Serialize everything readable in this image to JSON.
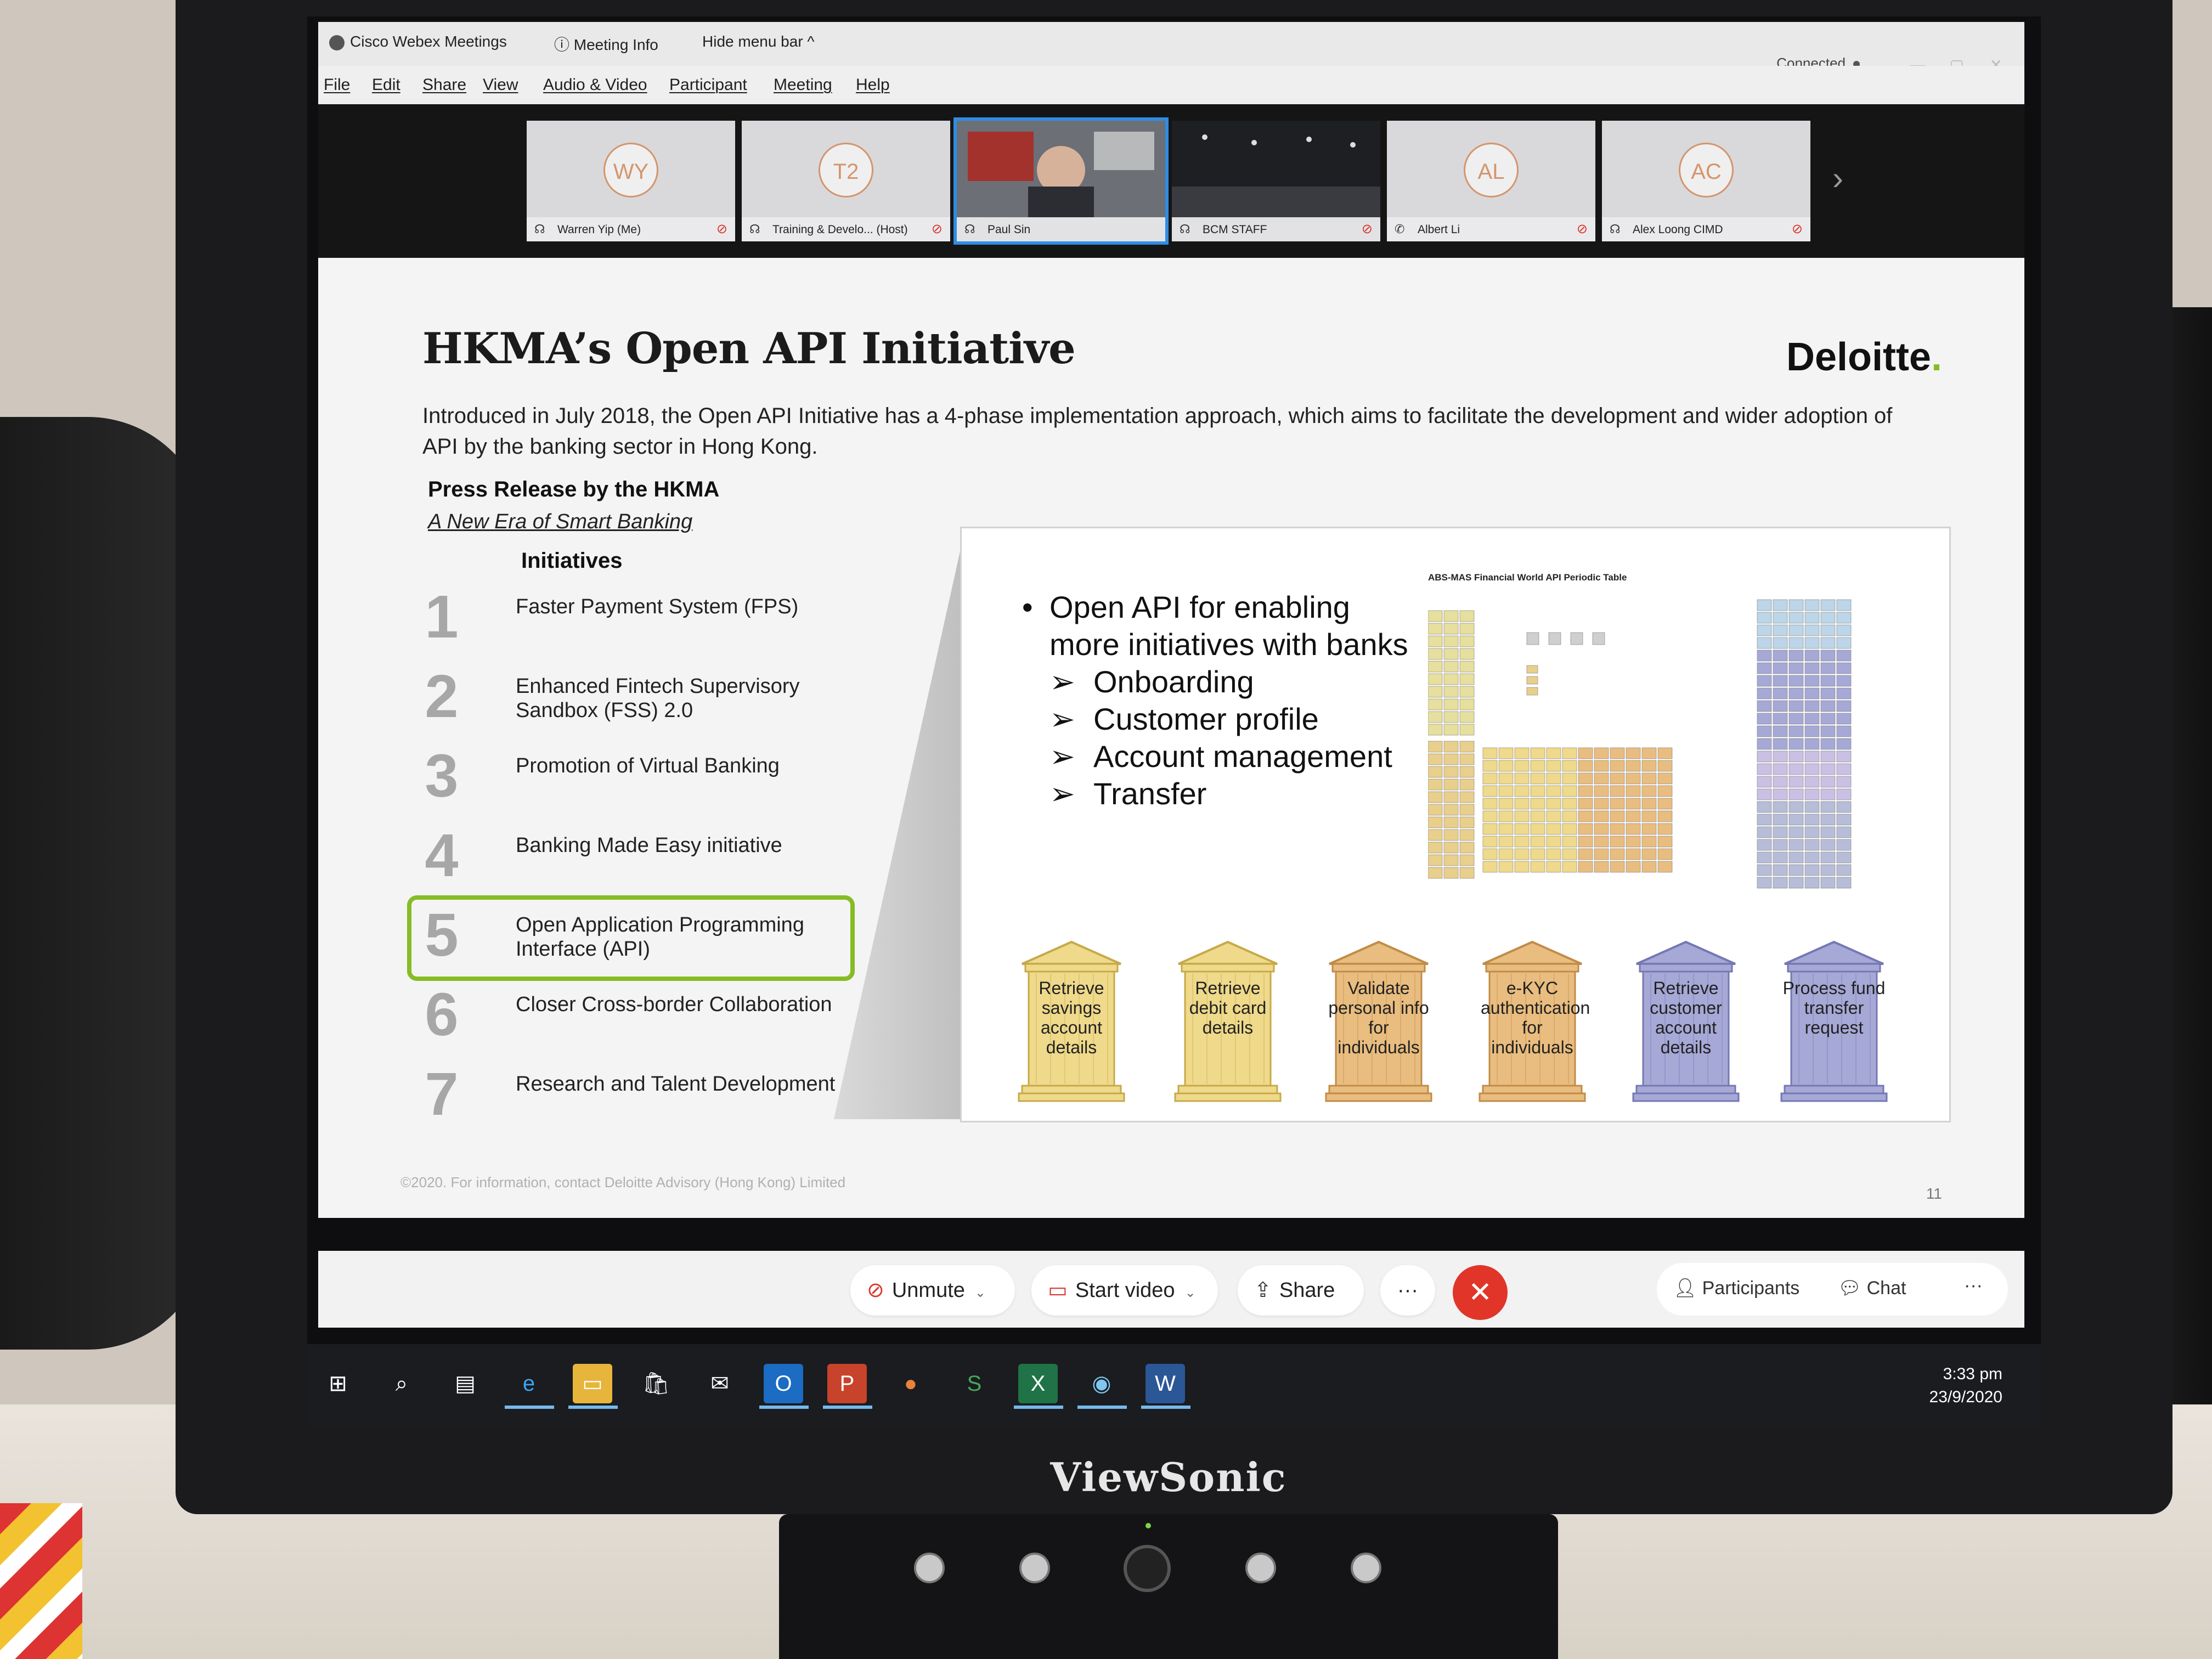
{
  "window": {
    "app_name": "Cisco Webex Meetings",
    "meeting_info": "Meeting Info",
    "hide_menu": "Hide menu bar ^",
    "status": "Connected"
  },
  "menu": [
    "File",
    "Edit",
    "Share",
    "View",
    "Audio & Video",
    "Participant",
    "Meeting",
    "Help"
  ],
  "participants": [
    {
      "initials": "WY",
      "name": "Warren Yip (Me)",
      "type": "avatar",
      "muted": true
    },
    {
      "initials": "T2",
      "name": "Training & Develo... (Host)",
      "type": "avatar",
      "muted": true
    },
    {
      "initials": "",
      "name": "Paul Sin",
      "type": "video",
      "muted": false,
      "active": true
    },
    {
      "initials": "",
      "name": "BCM STAFF",
      "type": "video",
      "muted": true
    },
    {
      "initials": "AL",
      "name": "Albert Li",
      "type": "avatar",
      "muted": true
    },
    {
      "initials": "AC",
      "name": "Alex Loong CIMD",
      "type": "avatar",
      "muted": true
    }
  ],
  "slide": {
    "title": "HKMA’s Open API Initiative",
    "logo": "Deloitte",
    "logo_dot": ".",
    "intro": "Introduced in July 2018, the Open API Initiative has a 4-phase implementation approach, which aims to facilitate the development and wider adoption of API by the banking sector in Hong Kong.",
    "press_heading": "Press Release by the HKMA",
    "press_link": "A New Era of Smart Banking",
    "initiatives_heading": "Initiatives",
    "initiatives": [
      {
        "num": "1",
        "text": "Faster Payment System (FPS)"
      },
      {
        "num": "2",
        "text": "Enhanced Fintech Supervisory Sandbox (FSS) 2.0"
      },
      {
        "num": "3",
        "text": "Promotion of Virtual Banking"
      },
      {
        "num": "4",
        "text": "Banking Made Easy initiative"
      },
      {
        "num": "5",
        "text": "Open Application Programming Interface (API)"
      },
      {
        "num": "6",
        "text": "Closer Cross-border Collaboration"
      },
      {
        "num": "7",
        "text": "Research and Talent Development"
      }
    ],
    "highlight_index": 4,
    "bullet_main": "Open API for enabling more initiatives with banks",
    "sub_bullets": [
      "Onboarding",
      "Customer profile",
      "Account management",
      "Transfer"
    ],
    "periodic_title": "ABS-MAS Financial World API Periodic Table",
    "pillars": [
      {
        "label": "Retrieve savings account details",
        "color": "#efd98a",
        "edge": "#c7a94a"
      },
      {
        "label": "Retrieve debit card details",
        "color": "#efd98a",
        "edge": "#c7a94a"
      },
      {
        "label": "Validate personal info for individuals",
        "color": "#e9bd7f",
        "edge": "#c18c48"
      },
      {
        "label": "e-KYC authentication for individuals",
        "color": "#e9bd7f",
        "edge": "#c18c48"
      },
      {
        "label": "Retrieve customer account details",
        "color": "#a6a8d6",
        "edge": "#7578b3"
      },
      {
        "label": "Process fund transfer request",
        "color": "#a6a8d6",
        "edge": "#7578b3"
      }
    ],
    "footer": "©2020. For information, contact Deloitte Advisory (Hong Kong) Limited",
    "page": "11"
  },
  "controls": {
    "unmute": "Unmute",
    "start_video": "Start video",
    "share": "Share",
    "more": "···",
    "participants": "Participants",
    "chat": "Chat"
  },
  "taskbar": {
    "time": "3:33 pm",
    "date": "23/9/2020"
  },
  "monitor": {
    "brand": "ViewSonic"
  }
}
